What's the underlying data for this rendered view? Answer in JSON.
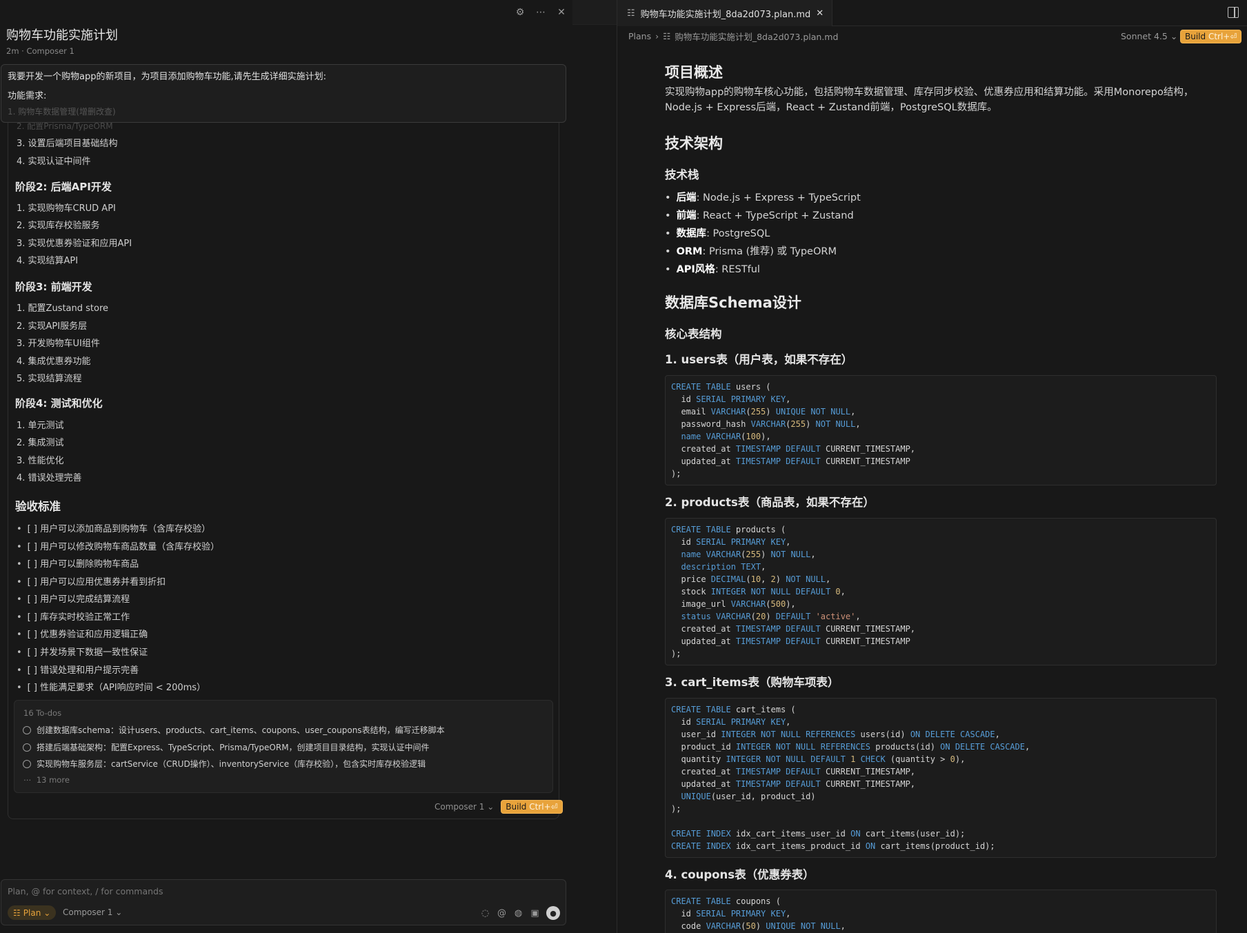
{
  "chat": {
    "title": "购物车功能实施计划",
    "meta": "2m · Composer 1",
    "user_message_line1": "我要开发一个购物app的新项目，为项目添加购物车功能,请先生成详细实施计划:",
    "user_message_line2": "功能需求:",
    "user_message_line3": "1. 购物车数据管理(增删改查)",
    "ghost_line": "2. 配置Prisma/TypeORM"
  },
  "plan": {
    "stage1_items": [
      "3. 设置后端项目基础结构",
      "4. 实现认证中间件"
    ],
    "stage2_title": "阶段2: 后端API开发",
    "stage2_items": [
      "1. 实现购物车CRUD API",
      "2. 实现库存校验服务",
      "3. 实现优惠券验证和应用API",
      "4. 实现结算API"
    ],
    "stage3_title": "阶段3: 前端开发",
    "stage3_items": [
      "1. 配置Zustand store",
      "2. 实现API服务层",
      "3. 开发购物车UI组件",
      "4. 集成优惠券功能",
      "5. 实现结算流程"
    ],
    "stage4_title": "阶段4: 测试和优化",
    "stage4_items": [
      "1. 单元测试",
      "2. 集成测试",
      "3. 性能优化",
      "4. 错误处理完善"
    ],
    "acceptance_title": "验收标准",
    "acceptance_items": [
      "[ ] 用户可以添加商品到购物车（含库存校验）",
      "[ ] 用户可以修改购物车商品数量（含库存校验）",
      "[ ] 用户可以删除购物车商品",
      "[ ] 用户可以应用优惠券并看到折扣",
      "[ ] 用户可以完成结算流程",
      "[ ] 库存实时校验正常工作",
      "[ ] 优惠券验证和应用逻辑正确",
      "[ ] 并发场景下数据一致性保证",
      "[ ] 错误处理和用户提示完善",
      "[ ] 性能满足要求（API响应时间 < 200ms）"
    ]
  },
  "todos": {
    "count": "16 To-dos",
    "items": [
      "创建数据库schema：设计users、products、cart_items、coupons、user_coupons表结构，编写迁移脚本",
      "搭建后端基础架构：配置Express、TypeScript、Prisma/TypeORM，创建项目目录结构，实现认证中间件",
      "实现购物车服务层：cartService（CRUD操作）、inventoryService（库存校验），包含实时库存校验逻辑"
    ],
    "more": "13 more"
  },
  "card_footer": {
    "model": "Composer 1",
    "build_label": "Build",
    "build_kbd": "Ctrl+⏎"
  },
  "composer": {
    "placeholder": "Plan, @ for context, / for commands",
    "mode": "Plan",
    "model": "Composer 1"
  },
  "editor": {
    "tab_title": "购物车功能实施计划_8da2d073.plan.md",
    "breadcrumb_root": "Plans",
    "breadcrumb_file": "购物车功能实施计划_8da2d073.plan.md",
    "model": "Sonnet 4.5",
    "build_label": "Build",
    "build_kbd": "Ctrl+⏎"
  },
  "doc": {
    "h_overview": "项目概述",
    "overview_p1": "实现购物app的购物车核心功能，包括购物车数据管理、库存同步校验、优惠券应用和结算功能。采用Monorepo结构，",
    "overview_p2": "Node.js + Express后端，React + Zustand前端，PostgreSQL数据库。",
    "h_arch": "技术架构",
    "h_stack": "技术栈",
    "stack": [
      {
        "k": "后端",
        "v": ": Node.js + Express + TypeScript"
      },
      {
        "k": "前端",
        "v": ": React + TypeScript + Zustand"
      },
      {
        "k": "数据库",
        "v": ": PostgreSQL"
      },
      {
        "k": "ORM",
        "v": ": Prisma (推荐) 或 TypeORM"
      },
      {
        "k": "API风格",
        "v": ": RESTful"
      }
    ],
    "h_schema": "数据库Schema设计",
    "h_core": "核心表结构",
    "h_users": "1. users表（用户表，如果不存在）",
    "h_products": "2. products表（商品表，如果不存在）",
    "h_cart": "3. cart_items表（购物车项表）",
    "h_coupons": "4. coupons表（优惠券表）"
  }
}
